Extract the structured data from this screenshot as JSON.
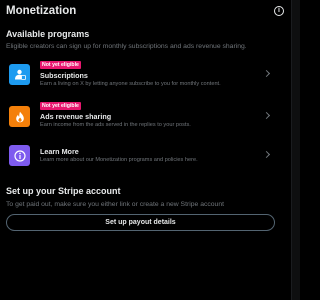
{
  "header": {
    "title": "Monetization",
    "info_glyph": "i"
  },
  "programs_section": {
    "title": "Available programs",
    "description": "Eligible creators can sign up for monthly subscriptions and ads revenue sharing."
  },
  "programs": [
    {
      "badge": "Not yet eligible",
      "title": "Subscriptions",
      "description": "Earn a living on X by letting anyone subscribe to you for monthly content.",
      "icon": "subscriptions-icon",
      "color": "#1d9bf0"
    },
    {
      "badge": "Not yet eligible",
      "title": "Ads revenue sharing",
      "description": "Earn income from the ads served in the replies to your posts.",
      "icon": "flame-icon",
      "color": "#f4800a"
    },
    {
      "title": "Learn More",
      "description": "Learn more about our Monetization programs and policies here.",
      "icon": "info-icon",
      "color": "#7e5bef"
    }
  ],
  "stripe_section": {
    "title": "Set up your Stripe account",
    "description": "To get paid out, make sure you either link or create a new Stripe account",
    "button_label": "Set up payout details"
  },
  "colors": {
    "background": "#000000",
    "badge": "#e8176f",
    "secondary_text": "#71767b"
  }
}
